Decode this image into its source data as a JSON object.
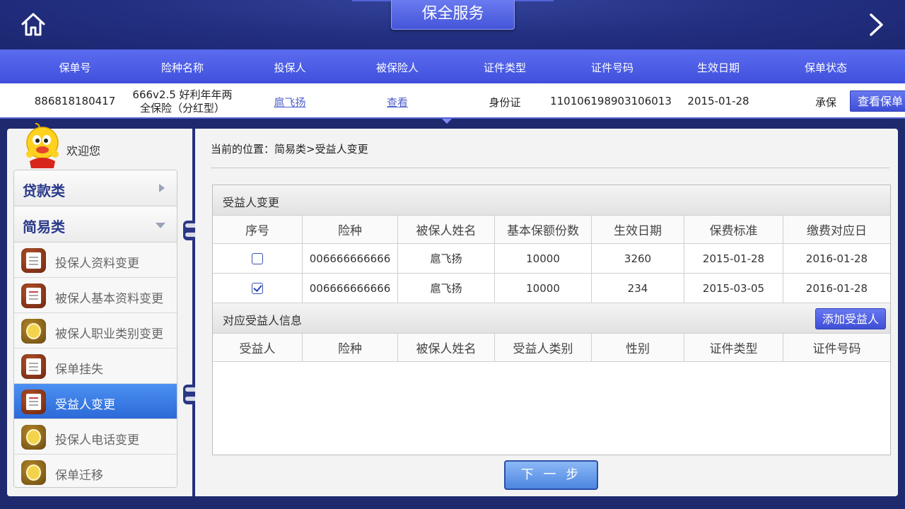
{
  "header": {
    "title": "保全服务"
  },
  "policy": {
    "columns": [
      "保单号",
      "险种名称",
      "投保人",
      "被保险人",
      "证件类型",
      "证件号码",
      "生效日期",
      "保单状态"
    ],
    "policy_no": "886818180417",
    "product_line1": "666v2.5 好利年年两",
    "product_line2": "全保险（分红型）",
    "applicant": "扈飞扬",
    "insured_link": "查看",
    "id_type": "身份证",
    "id_no": "110106198903106013",
    "effective_date": "2015-01-28",
    "status": "承保",
    "view_button": "查看保单"
  },
  "sidebar": {
    "welcome": "欢迎您",
    "categories": [
      {
        "label": "贷款类"
      },
      {
        "label": "简易类"
      }
    ],
    "items": [
      {
        "label": "投保人资料变更"
      },
      {
        "label": "被保人基本资料变更"
      },
      {
        "label": "被保人职业类别变更"
      },
      {
        "label": "保单挂失"
      },
      {
        "label": "受益人变更"
      },
      {
        "label": "投保人电话变更"
      },
      {
        "label": "保单迁移"
      }
    ]
  },
  "main": {
    "breadcrumb": "当前的位置：简易类>受益人变更",
    "section1_title": "受益人变更",
    "table1": {
      "headers": [
        "序号",
        "险种",
        "被保人姓名",
        "基本保额份数",
        "生效日期",
        "保费标准",
        "缴费对应日"
      ],
      "rows": [
        {
          "checked": false,
          "product": "006666666666",
          "insured": "扈飞扬",
          "units": "10000",
          "effective": "3260",
          "premium": "2015-01-28",
          "due": "2016-01-28"
        },
        {
          "checked": true,
          "product": "006666666666",
          "insured": "扈飞扬",
          "units": "10000",
          "effective": "234",
          "premium": "2015-03-05",
          "due": "2016-01-28"
        }
      ]
    },
    "section2_title": "对应受益人信息",
    "add_button": "添加受益人",
    "table2": {
      "headers": [
        "受益人",
        "险种",
        "被保人姓名",
        "受益人类别",
        "性别",
        "证件类型",
        "证件号码"
      ]
    },
    "next_button": "下 一 步"
  },
  "colors": {
    "background": "#1f2a6e",
    "accent": "#4a5ae0",
    "active_item": "#3a7be6"
  }
}
